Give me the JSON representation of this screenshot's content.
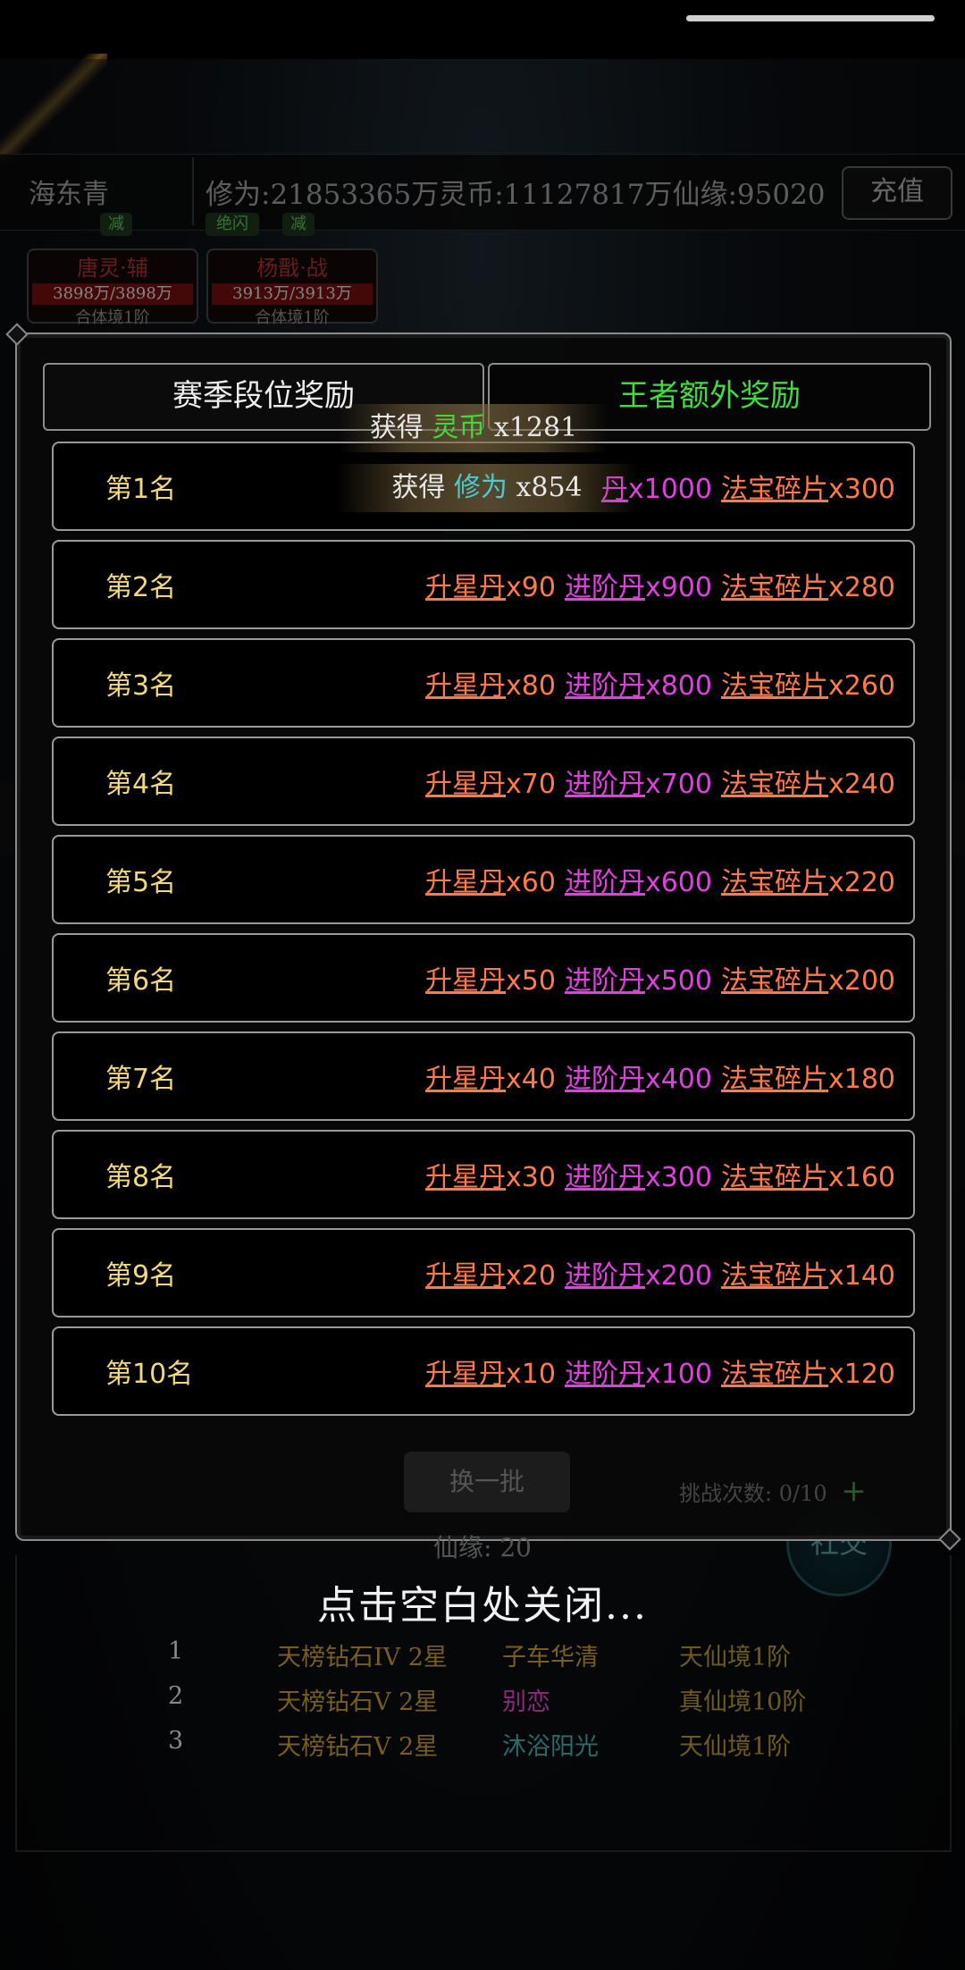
{
  "header": {
    "player_name": "海东青",
    "stats_text": "修为:21853365万灵币:11127817万仙缘:95020",
    "recharge_label": "充值"
  },
  "background_cards": [
    {
      "name": "唐灵·辅",
      "hp": "3898万/3898万",
      "realm": "合体境1阶"
    },
    {
      "name": "杨戬·战",
      "hp": "3913万/3913万",
      "realm": "合体境1阶"
    }
  ],
  "background_tags": {
    "tag1": "减",
    "tag2": "绝闪",
    "tag3": "减"
  },
  "dialog": {
    "tabs": [
      {
        "label": "赛季段位奖励",
        "active": true
      },
      {
        "label": "王者额外奖励",
        "active": false
      }
    ],
    "reward_rows": [
      {
        "rank": "第1名",
        "star_pill": "",
        "star_qty": "",
        "adv_pill": "丹",
        "adv_qty": "x1000",
        "fragment": "法宝碎片",
        "fragment_qty": "x300"
      },
      {
        "rank": "第2名",
        "star_pill": "升星丹",
        "star_qty": "x90",
        "adv_pill": "进阶丹",
        "adv_qty": "x900",
        "fragment": "法宝碎片",
        "fragment_qty": "x280"
      },
      {
        "rank": "第3名",
        "star_pill": "升星丹",
        "star_qty": "x80",
        "adv_pill": "进阶丹",
        "adv_qty": "x800",
        "fragment": "法宝碎片",
        "fragment_qty": "x260"
      },
      {
        "rank": "第4名",
        "star_pill": "升星丹",
        "star_qty": "x70",
        "adv_pill": "进阶丹",
        "adv_qty": "x700",
        "fragment": "法宝碎片",
        "fragment_qty": "x240"
      },
      {
        "rank": "第5名",
        "star_pill": "升星丹",
        "star_qty": "x60",
        "adv_pill": "进阶丹",
        "adv_qty": "x600",
        "fragment": "法宝碎片",
        "fragment_qty": "x220"
      },
      {
        "rank": "第6名",
        "star_pill": "升星丹",
        "star_qty": "x50",
        "adv_pill": "进阶丹",
        "adv_qty": "x500",
        "fragment": "法宝碎片",
        "fragment_qty": "x200"
      },
      {
        "rank": "第7名",
        "star_pill": "升星丹",
        "star_qty": "x40",
        "adv_pill": "进阶丹",
        "adv_qty": "x400",
        "fragment": "法宝碎片",
        "fragment_qty": "x180"
      },
      {
        "rank": "第8名",
        "star_pill": "升星丹",
        "star_qty": "x30",
        "adv_pill": "进阶丹",
        "adv_qty": "x300",
        "fragment": "法宝碎片",
        "fragment_qty": "x160"
      },
      {
        "rank": "第9名",
        "star_pill": "升星丹",
        "star_qty": "x20",
        "adv_pill": "进阶丹",
        "adv_qty": "x200",
        "fragment": "法宝碎片",
        "fragment_qty": "x140"
      },
      {
        "rank": "第10名",
        "star_pill": "升星丹",
        "star_qty": "x10",
        "adv_pill": "进阶丹",
        "adv_qty": "x100",
        "fragment": "法宝碎片",
        "fragment_qty": "x120"
      }
    ]
  },
  "toasts": [
    {
      "prefix": "获得",
      "item": "灵币",
      "qty": "x1281"
    },
    {
      "prefix": "获得",
      "item": "修为",
      "qty": "x854"
    }
  ],
  "behind": {
    "refresh_label": "换一批",
    "challenge_text": "挑战次数: 0/10",
    "challenge_plus": "+",
    "xianyuan_text": "仙缘: 20",
    "social_label": "社交"
  },
  "close_hint": "点击空白处关闭...",
  "leaderboard": [
    {
      "num": "1",
      "tier": "天榜钻石IV 2星",
      "player": "子车华清",
      "player_color": "#7a5e20",
      "realm": "天仙境1阶"
    },
    {
      "num": "2",
      "tier": "天榜钻石V 2星",
      "player": "别恋",
      "player_color": "#8a2a7a",
      "realm": "真仙境10阶"
    },
    {
      "num": "3",
      "tier": "天榜钻石V 2星",
      "player": "沐浴阳光",
      "player_color": "#2a6a6a",
      "realm": "天仙境1阶"
    }
  ],
  "colors": {
    "rank_gold": "#f3d87a",
    "star_pill_orange": "#ff7a4a",
    "adv_pill_magenta": "#e040e0",
    "king_tab_green": "#3fdc3f"
  }
}
